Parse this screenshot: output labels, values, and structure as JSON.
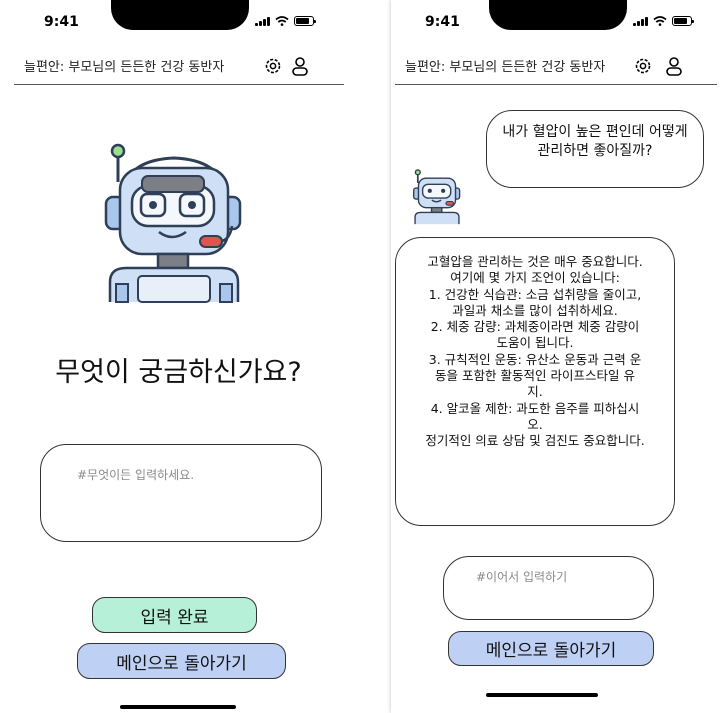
{
  "status": {
    "time": "9:41"
  },
  "app": {
    "title": "늘편안: 부모님의 든든한 건강 동반자"
  },
  "left": {
    "question": "무엇이 궁금하신가요?",
    "input_placeholder": "#무엇이든 입력하세요.",
    "submit_label": "입력 완료",
    "home_label": "메인으로 돌아가기"
  },
  "right": {
    "user_message": "내가 혈압이 높은 편인데 어떻게 관리하면 좋아질까?",
    "answer_lines": [
      "고혈압을 관리하는 것은 매우 중요합니다.",
      "여기에 몇 가지 조언이 있습니다:",
      "1. 건강한 식습관: 소금 섭취량을 줄이고,",
      "과일과 채소를 많이 섭취하세요.",
      "2. 체중 감량: 과체중이라면 체중 감량이",
      "도움이 됩니다.",
      "3. 규칙적인 운동: 유산소 운동과 근력 운",
      "동을 포함한 활동적인 라이프스타일 유",
      "지.",
      "4. 알코올 제한: 과도한 음주를 피하십시",
      "오.",
      "정기적인 의료 상담 및 검진도 중요합니다."
    ],
    "input_placeholder": "#이어서 입력하기",
    "home_label": "메인으로 돌아가기"
  },
  "icons": {
    "settings": "gear-icon",
    "profile": "user-icon",
    "assistant": "robot-icon"
  },
  "colors": {
    "submit_bg": "#b7f0d9",
    "home_bg": "#bfd0f5",
    "robot_face": "#a9c6ec"
  }
}
